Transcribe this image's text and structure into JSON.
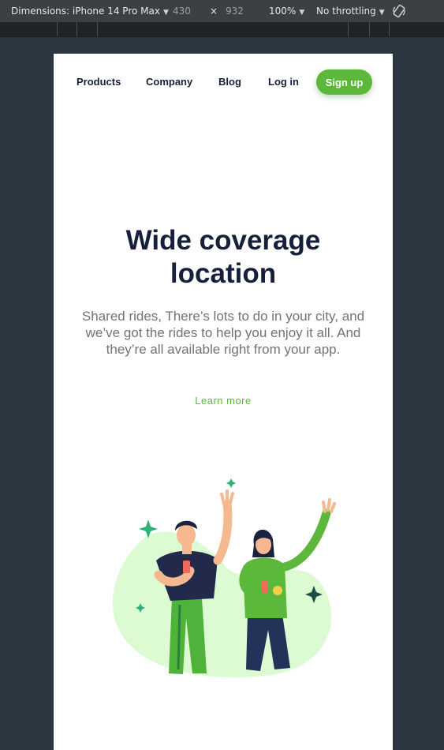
{
  "devtools": {
    "dimensions_label": "Dimensions: iPhone 14 Pro Max",
    "width": "430",
    "times": "×",
    "height": "932",
    "zoom": "100%",
    "throttling": "No throttling",
    "rotate_icon": "rotate-icon"
  },
  "nav": {
    "products": "Products",
    "company": "Company",
    "blog": "Blog",
    "login": "Log in",
    "signup": "Sign up"
  },
  "hero": {
    "title_line1": "Wide coverage",
    "title_line2": "location",
    "description": "Shared rides, There’s lots to do in your city, and we’ve got the rides to help you enjoy it all. And they’re all available right from your app.",
    "learn_more": "Learn more"
  },
  "colors": {
    "accent": "#5cb83a",
    "heading": "#17203a",
    "body_text": "#6f7378",
    "blob": "#dcfbd2"
  }
}
